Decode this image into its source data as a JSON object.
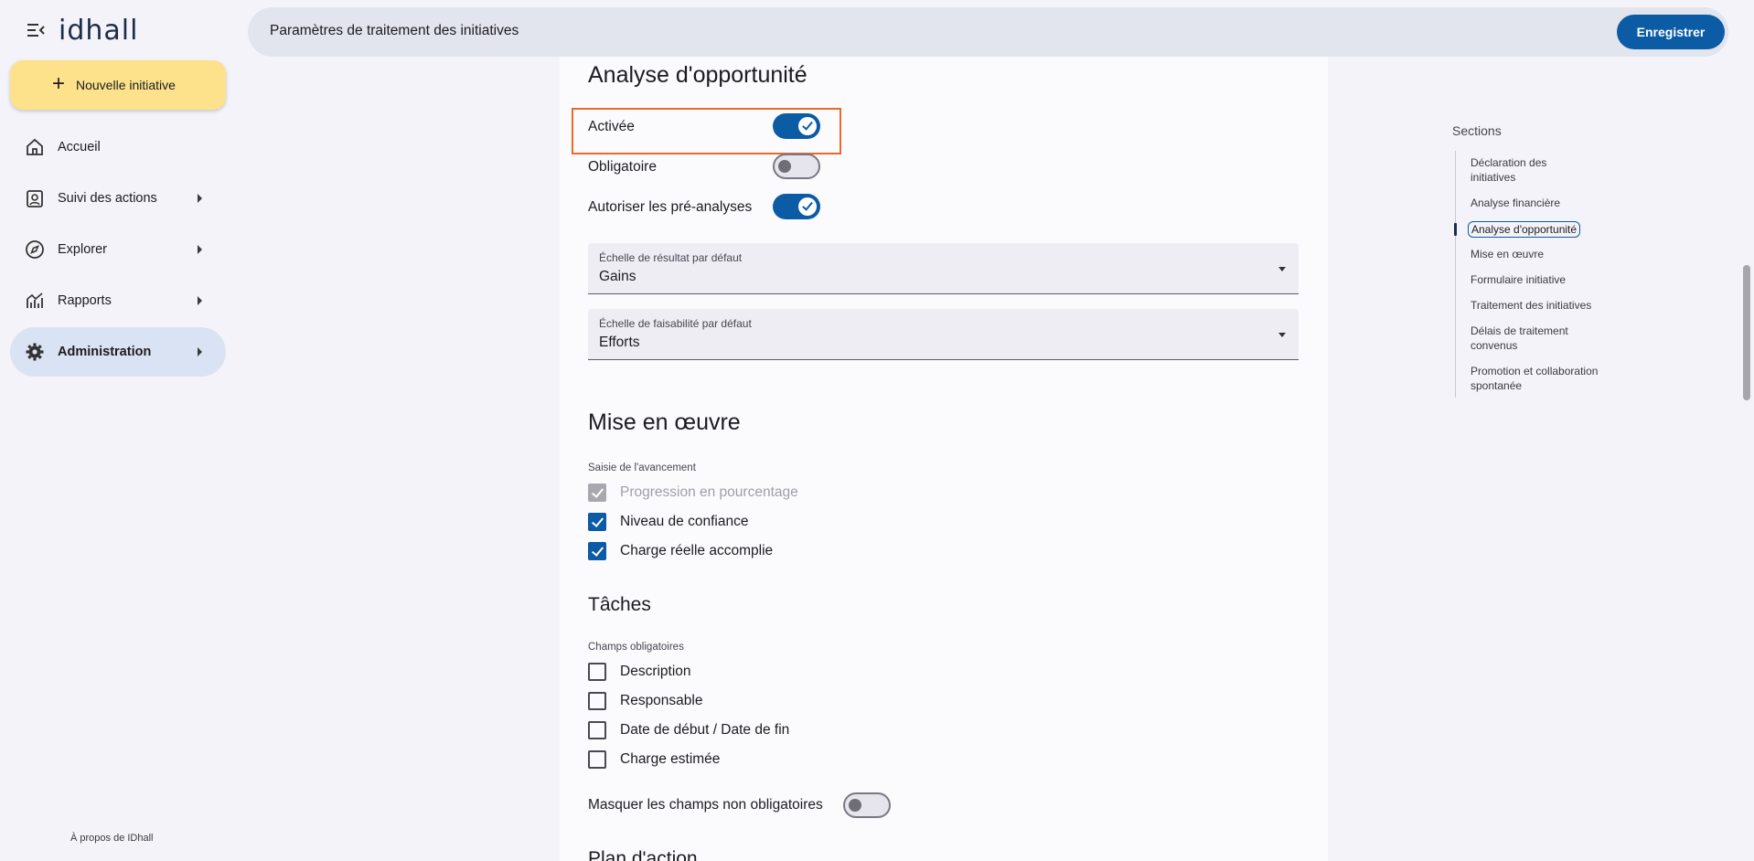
{
  "app": {
    "logo": "idhall"
  },
  "sidebar": {
    "new_button_label": "Nouvelle initiative",
    "items": [
      {
        "label": "Accueil",
        "icon": "home-icon"
      },
      {
        "label": "Suivi des actions",
        "icon": "clipboard-user-icon"
      },
      {
        "label": "Explorer",
        "icon": "compass-icon"
      },
      {
        "label": "Rapports",
        "icon": "chart-icon"
      },
      {
        "label": "Administration",
        "icon": "gear-icon"
      }
    ],
    "about_label": "À propos de IDhall"
  },
  "header": {
    "title": "Paramètres de traitement des initiatives",
    "save_label": "Enregistrer"
  },
  "opportunity": {
    "title": "Analyse d'opportunité",
    "enabled_label": "Activée",
    "enabled": true,
    "mandatory_label": "Obligatoire",
    "mandatory": false,
    "pre_analysis_label": "Autoriser les pré-analyses",
    "pre_analysis": true,
    "result_scale_label": "Échelle de résultat par défaut",
    "result_scale_value": "Gains",
    "feasibility_scale_label": "Échelle de faisabilité par défaut",
    "feasibility_scale_value": "Efforts"
  },
  "implementation": {
    "title": "Mise en œuvre",
    "progress_caption": "Saisie de l'avancement",
    "options": [
      {
        "label": "Progression en pourcentage",
        "state": "disabled"
      },
      {
        "label": "Niveau de confiance",
        "state": "checked"
      },
      {
        "label": "Charge réelle accomplie",
        "state": "checked"
      }
    ]
  },
  "tasks": {
    "title": "Tâches",
    "caption": "Champs obligatoires",
    "fields": [
      {
        "label": "Description",
        "checked": false
      },
      {
        "label": "Responsable",
        "checked": false
      },
      {
        "label": "Date de début / Date de fin",
        "checked": false
      },
      {
        "label": "Charge estimée",
        "checked": false
      }
    ],
    "hide_label": "Masquer les champs non obligatoires",
    "hide": false
  },
  "next_section_title": "Plan d'action",
  "toc": {
    "title": "Sections",
    "items": [
      "Déclaration des initiatives",
      "Analyse financière",
      "Analyse d'opportunité",
      "Mise en œuvre",
      "Formulaire initiative",
      "Traitement des initiatives",
      "Délais de traitement convenus",
      "Promotion et collaboration spontanée"
    ],
    "active_index": 2
  },
  "colors": {
    "accent": "#0b5ba5",
    "new_button": "#fde28b",
    "highlight": "#e8692c"
  }
}
